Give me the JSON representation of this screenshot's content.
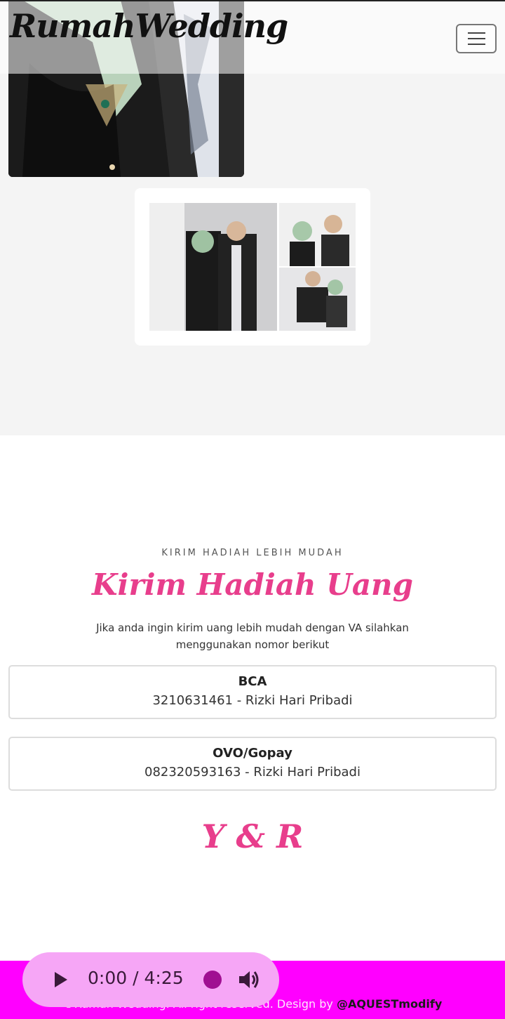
{
  "navbar": {
    "brand": "RumahWedding"
  },
  "gift": {
    "eyebrow": "KIRIM HADIAH LEBIH MUDAH",
    "title": "Kirim Hadiah Uang",
    "description": "Jika anda ingin kirim uang lebih mudah dengan VA silahkan menggunakan nomor berikut",
    "accounts": [
      {
        "name": "BCA",
        "number": "3210631461 - Rizki Hari Pribadi"
      },
      {
        "name": "OVO/Gopay",
        "number": "082320593163 - Rizki Hari Pribadi"
      }
    ]
  },
  "initials": "Y & R",
  "player": {
    "current_time": "0:00",
    "separator": "/",
    "duration": "4:25",
    "icons": [
      "play-icon",
      "record-icon",
      "volume-icon"
    ]
  },
  "footer": {
    "text": "©Rumah Wedding. All right reserved. Design by ",
    "designer": "@AQUESTmodify"
  },
  "colors": {
    "accent": "#e83e8c",
    "footer_bg": "#ff00ff",
    "gallery_bg": "#f4f4f4"
  }
}
